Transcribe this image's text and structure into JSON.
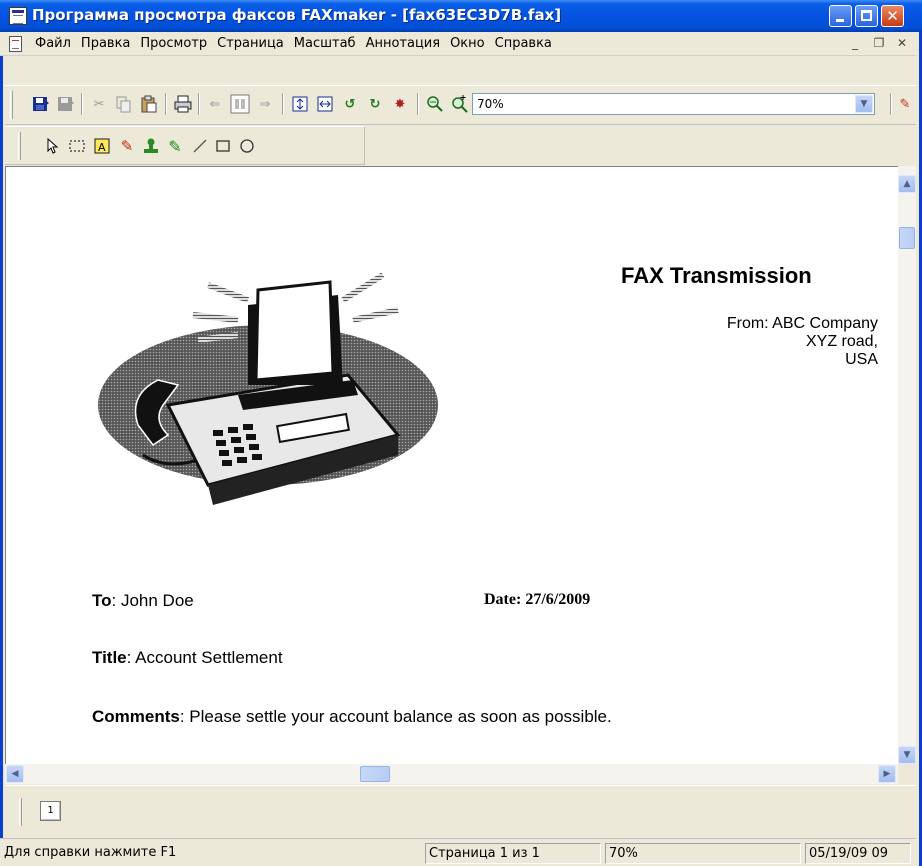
{
  "window": {
    "title": "Программа просмотра факсов FAXmaker - [fax63EC3D7B.fax]"
  },
  "menu": {
    "items": [
      "Файл",
      "Правка",
      "Просмотр",
      "Страница",
      "Масштаб",
      "Аннотация",
      "Окно",
      "Справка"
    ]
  },
  "toolbar": {
    "zoom_value": "70%"
  },
  "fax": {
    "heading": "FAX Transmission",
    "from_line": "From: ABC Company",
    "address_line1": "XYZ road,",
    "address_line2": "USA",
    "to_label": "To",
    "to_value": ": John Doe",
    "date_label": "Date",
    "date_value": ": 27/6/2009",
    "title_label": "Title",
    "title_value": ": Account Settlement",
    "comments_label": "Comments",
    "comments_value": ": Please settle your account balance as soon as possible."
  },
  "pages": {
    "thumb_label": "1"
  },
  "status": {
    "help": "Для справки нажмите F1",
    "page": "Страница 1 из 1",
    "zoom": "70%",
    "datetime": "05/19/09 09"
  }
}
